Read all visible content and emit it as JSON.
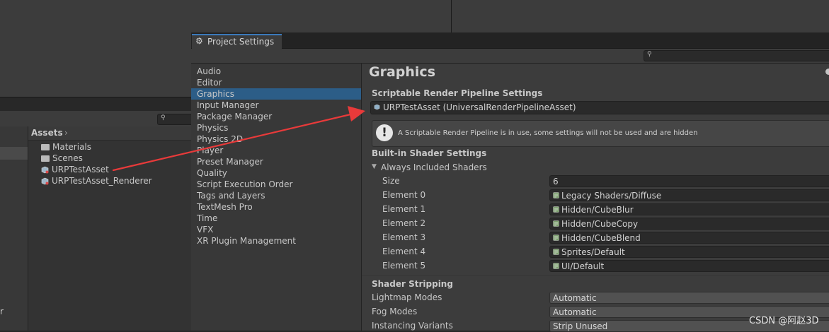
{
  "project_panel": {
    "breadcrumb": "Assets",
    "items": [
      {
        "label": "Materials",
        "icon": "folder-icon"
      },
      {
        "label": "Scenes",
        "icon": "folder-icon"
      },
      {
        "label": "URPTestAsset",
        "icon": "pipeline-asset-icon"
      },
      {
        "label": "URPTestAsset_Renderer",
        "icon": "pipeline-asset-icon"
      }
    ],
    "tree_partial_text": "r"
  },
  "window": {
    "tab_label": "Project Settings",
    "tab_icon": "gear-icon"
  },
  "sidebar": {
    "selected": "Graphics",
    "items": [
      {
        "label": "Audio"
      },
      {
        "label": "Editor"
      },
      {
        "label": "Graphics"
      },
      {
        "label": "Input Manager"
      },
      {
        "label": "Package Manager"
      },
      {
        "label": "Physics"
      },
      {
        "label": "Physics 2D"
      },
      {
        "label": "Player"
      },
      {
        "label": "Preset Manager"
      },
      {
        "label": "Quality"
      },
      {
        "label": "Script Execution Order"
      },
      {
        "label": "Tags and Layers"
      },
      {
        "label": "TextMesh Pro"
      },
      {
        "label": "Time"
      },
      {
        "label": "VFX"
      },
      {
        "label": "XR Plugin Management"
      }
    ]
  },
  "graphics": {
    "title": "Graphics",
    "srp_header": "Scriptable Render Pipeline Settings",
    "srp_value": "URPTestAsset (UniversalRenderPipelineAsset)",
    "info_message": "A Scriptable Render Pipeline is in use, some settings will not be used and are hidden",
    "builtin_header": "Built-in Shader Settings",
    "always_included_label": "Always Included Shaders",
    "size_label": "Size",
    "size_value": "6",
    "shaders": [
      {
        "label": "Element 0",
        "value": "Legacy Shaders/Diffuse"
      },
      {
        "label": "Element 1",
        "value": "Hidden/CubeBlur"
      },
      {
        "label": "Element 2",
        "value": "Hidden/CubeCopy"
      },
      {
        "label": "Element 3",
        "value": "Hidden/CubeBlend"
      },
      {
        "label": "Element 4",
        "value": "Sprites/Default"
      },
      {
        "label": "Element 5",
        "value": "UI/Default"
      }
    ],
    "stripping_header": "Shader Stripping",
    "stripping": [
      {
        "label": "Lightmap Modes",
        "value": "Automatic"
      },
      {
        "label": "Fog Modes",
        "value": "Automatic"
      },
      {
        "label": "Instancing Variants",
        "value": "Strip Unused"
      }
    ]
  },
  "watermark": "CSDN @阿赵3D",
  "colors": {
    "selection": "#2c5d87",
    "tab_accent": "#3a79bb",
    "annotation_arrow": "#e83a3a"
  }
}
